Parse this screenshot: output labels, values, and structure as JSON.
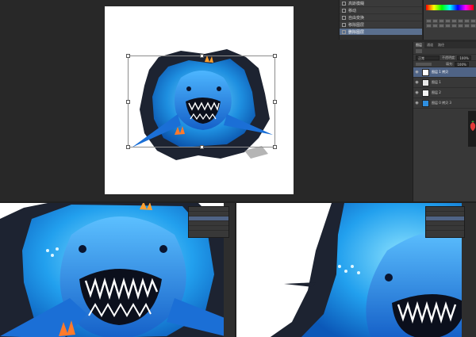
{
  "history": {
    "items": [
      {
        "label": "高斯模糊",
        "active": false
      },
      {
        "label": "移动",
        "active": false
      },
      {
        "label": "自由变换",
        "active": false
      },
      {
        "label": "移除图层",
        "active": false
      },
      {
        "label": "删除图层",
        "active": true
      }
    ]
  },
  "layers": {
    "tabs": [
      "图层",
      "通道",
      "路径"
    ],
    "blend_mode": "正常",
    "opacity_label": "不透明度:",
    "opacity_value": "100%",
    "fill_label": "填充:",
    "fill_value": "100%",
    "items": [
      {
        "name": "图层 1 拷贝",
        "active": true
      },
      {
        "name": "图层 1",
        "active": false
      },
      {
        "name": "图层 2",
        "active": false
      },
      {
        "name": "图层 0 拷贝 3",
        "active": false
      }
    ]
  },
  "colors": {
    "accent_blue": "#2f8fe0",
    "shark_blue": "#3aa0ea",
    "rock_dark": "#1e2330",
    "layer_selected": "#4f6385"
  }
}
